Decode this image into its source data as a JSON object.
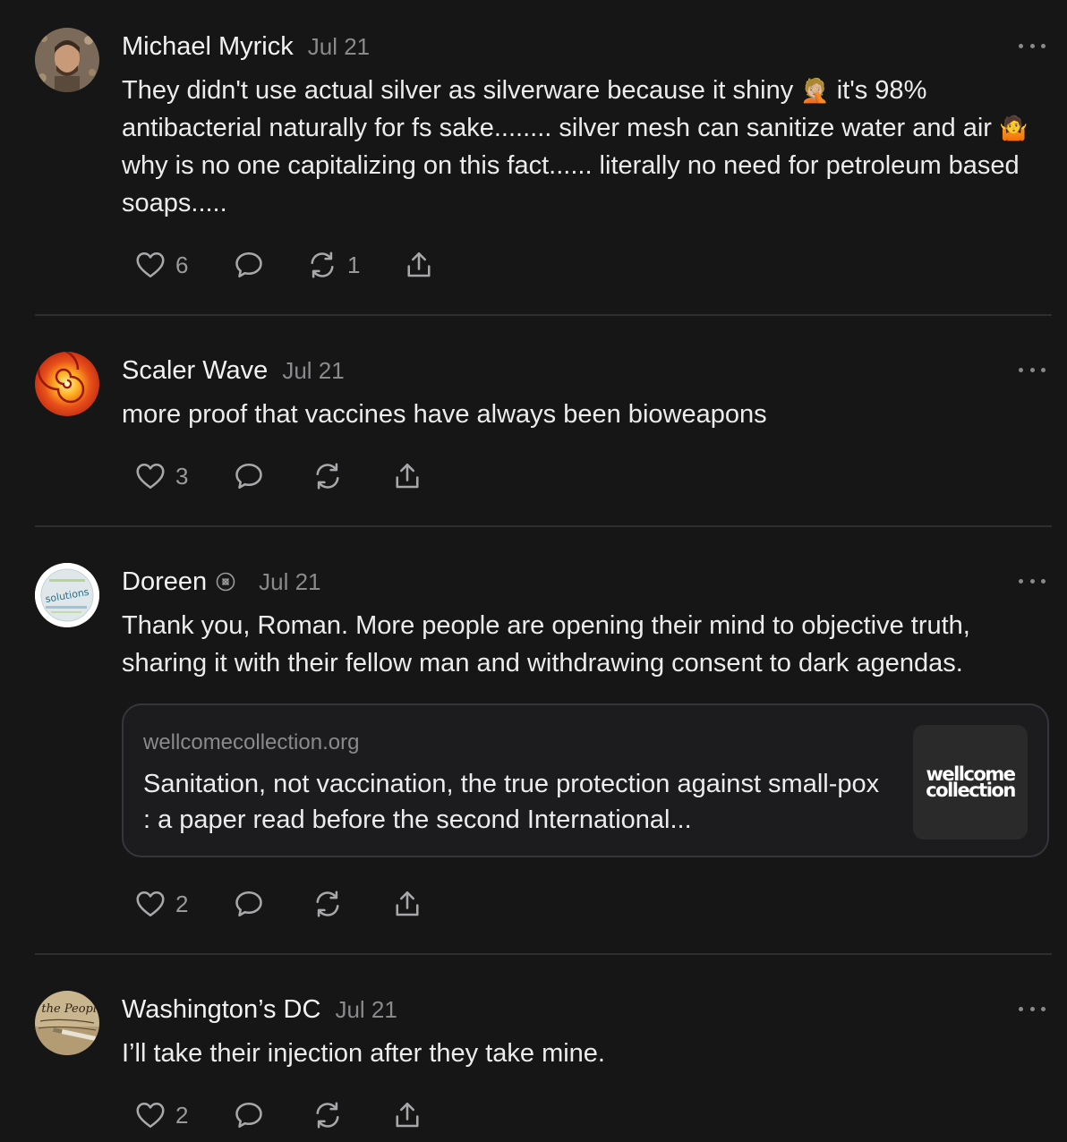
{
  "posts": [
    {
      "author": "Michael Myrick",
      "date": "Jul 21",
      "text_a": "They didn't use actual silver as silverware because it shiny ",
      "emoji_a": "🤦🏼",
      "text_b": " it's 98% antibacterial naturally for fs sake........ silver mesh can sanitize water and air ",
      "emoji_b": "🤷",
      "text_c": " why is no one capitalizing on this fact...... literally no need for petroleum based soaps.....",
      "likes": "6",
      "restacks": "1"
    },
    {
      "author": "Scaler Wave",
      "date": "Jul 21",
      "text": "more proof that vaccines have always been bioweapons",
      "likes": "3",
      "restacks": ""
    },
    {
      "author": "Doreen",
      "date": "Jul 21",
      "avatar_text": "solutions",
      "text": "Thank you, Roman. More people are opening their mind to objective truth, sharing it with their fellow man and withdrawing consent to dark agendas.",
      "link": {
        "domain": "wellcomecollection.org",
        "title": "Sanitation, not vaccination, the true protection against small-pox : a paper read before the second International...",
        "thumb_line1": "wellcome",
        "thumb_line2": "collection"
      },
      "likes": "2",
      "restacks": ""
    },
    {
      "author": "Washington’s DC",
      "date": "Jul 21",
      "avatar_text": "We the People",
      "text": "I’ll take their injection after they take mine.",
      "likes": "2",
      "restacks": ""
    }
  ],
  "icons": [
    "heart-icon",
    "comment-icon",
    "restack-icon",
    "share-icon",
    "more-icon",
    "badge-icon"
  ]
}
